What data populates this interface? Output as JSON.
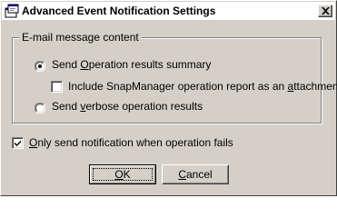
{
  "window": {
    "title": "Advanced Event Notification Settings",
    "app_icon": "app-window-icon",
    "close_icon": "close-icon"
  },
  "group": {
    "label": "E-mail message content"
  },
  "options": {
    "summary": {
      "label_pre": "Send ",
      "label_u": "O",
      "label_post": "peration results summary",
      "checked": true
    },
    "include_report": {
      "label_pre": "Include SnapManager operation report as an ",
      "label_u": "a",
      "label_post": "ttachment",
      "checked": false
    },
    "verbose": {
      "label_pre": "Send ",
      "label_u": "v",
      "label_post": "erbose operation results",
      "checked": false
    }
  },
  "only_fail": {
    "label_u": "O",
    "label_post": "nly send notification when operation fails",
    "checked": true
  },
  "buttons": {
    "ok": {
      "label_u": "O",
      "label_post": "K"
    },
    "cancel": {
      "label_u": "C",
      "label_post": "ancel"
    }
  }
}
